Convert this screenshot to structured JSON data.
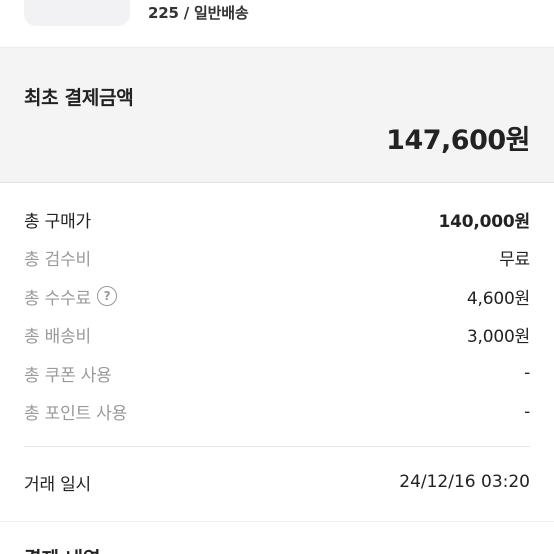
{
  "product": {
    "option_text": "225 / 일반배송"
  },
  "summary": {
    "label": "최초 결제금액",
    "amount": "147,600원"
  },
  "breakdown": [
    {
      "label": "총 구매가",
      "value": "140,000원"
    },
    {
      "label": "총 검수비",
      "value": "무료"
    },
    {
      "label": "총 수수료",
      "value": "4,600원",
      "help_icon": "?"
    },
    {
      "label": "총 배송비",
      "value": "3,000원"
    },
    {
      "label": "총 쿠폰 사용",
      "value": "-"
    },
    {
      "label": "총 포인트 사용",
      "value": "-"
    }
  ],
  "trade": {
    "label": "거래 일시",
    "value": "24/12/16 03:20"
  },
  "next_section": {
    "heading": "결제 내역"
  }
}
